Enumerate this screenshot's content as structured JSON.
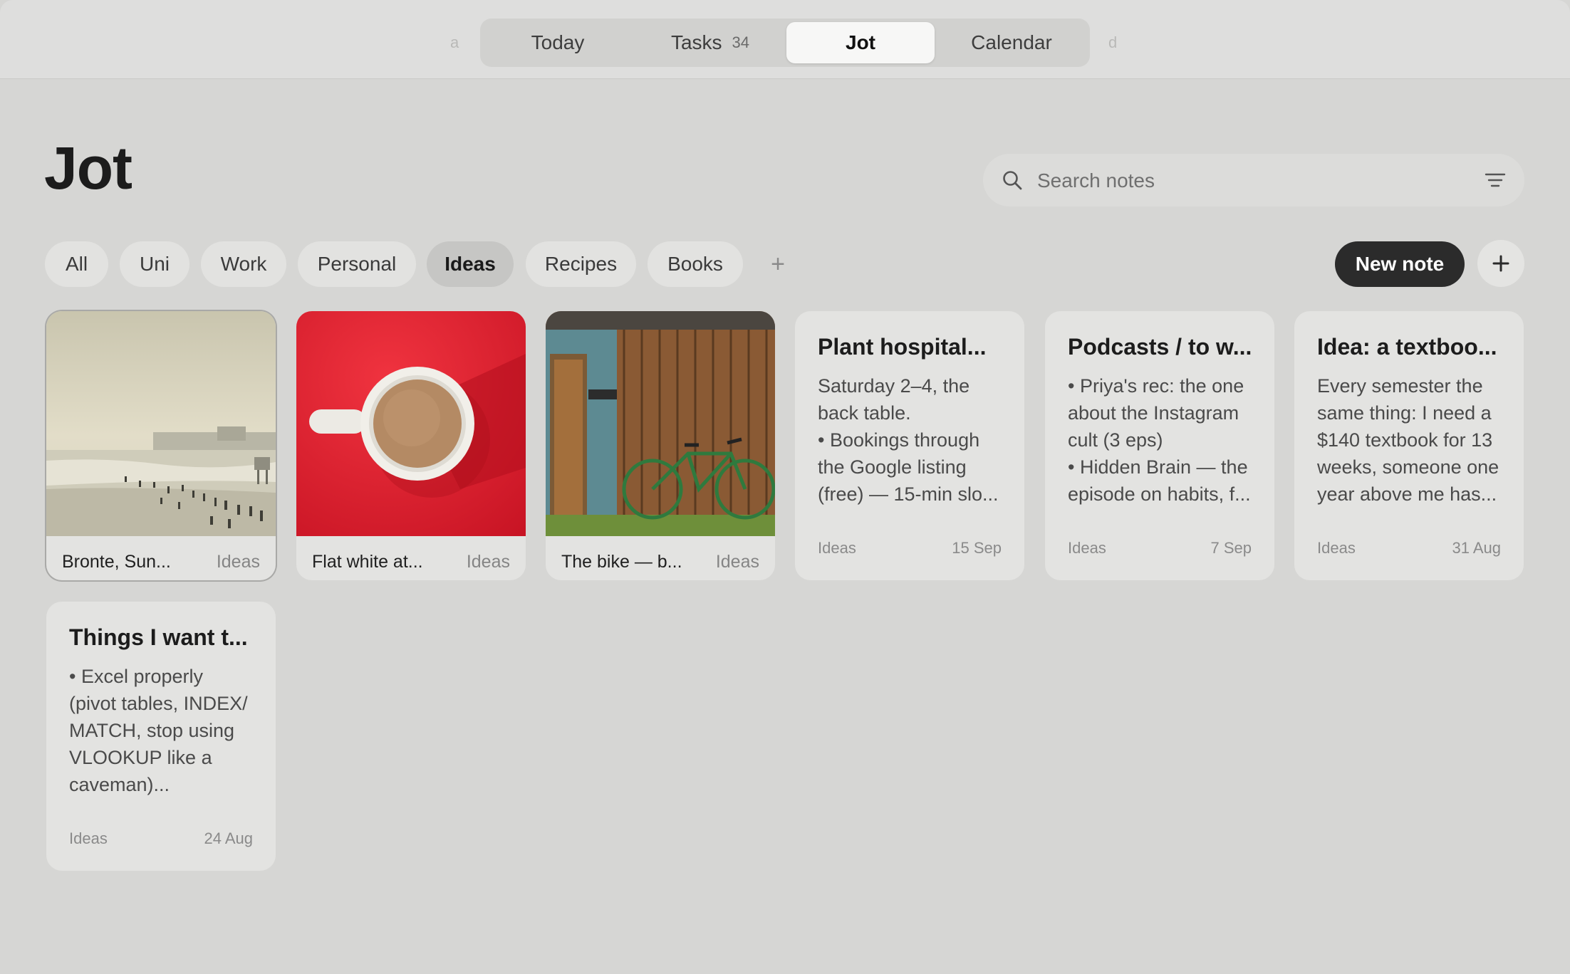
{
  "nav": {
    "hint_left": "a",
    "hint_right": "d",
    "tabs": [
      {
        "label": "Today"
      },
      {
        "label": "Tasks",
        "count": "34"
      },
      {
        "label": "Jot"
      },
      {
        "label": "Calendar"
      }
    ],
    "active_tab": "Jot"
  },
  "header": {
    "title": "Jot",
    "search_placeholder": "Search notes"
  },
  "filters": {
    "chips": [
      "All",
      "Uni",
      "Work",
      "Personal",
      "Ideas",
      "Recipes",
      "Books"
    ],
    "active": "Ideas",
    "add_symbol": "+"
  },
  "actions": {
    "new_note_label": "New note"
  },
  "notes": [
    {
      "type": "image",
      "image": "beach-scene",
      "title": "Bronte, Sun...",
      "tag": "Ideas",
      "selected": true
    },
    {
      "type": "image",
      "image": "coffee-cup-on-red",
      "title": "Flat white at...",
      "tag": "Ideas"
    },
    {
      "type": "image",
      "image": "bicycle-by-wooden-shed",
      "title": "The bike — b...",
      "tag": "Ideas"
    },
    {
      "type": "text",
      "title": "Plant hospital...",
      "body": "Saturday 2–4, the\nback table.\n• Bookings through\nthe Google listing\n(free) — 15-min slo...",
      "tag": "Ideas",
      "date": "15 Sep"
    },
    {
      "type": "text",
      "title": "Podcasts / to w...",
      "body": "• Priya's rec: the one\nabout the Instagram\ncult (3 eps)\n• Hidden Brain — the\nepisode on habits, f...",
      "tag": "Ideas",
      "date": "7 Sep"
    },
    {
      "type": "text",
      "title": "Idea: a textboo...",
      "body": "Every semester the\nsame thing: I need a\n$140 textbook for 13\nweeks, someone one\nyear above me has...",
      "tag": "Ideas",
      "date": "31 Aug"
    },
    {
      "type": "text",
      "title": "Things I want t...",
      "body": "• Excel properly\n(pivot tables, INDEX/\nMATCH, stop using\nVLOOKUP like a\ncaveman)...",
      "tag": "Ideas",
      "date": "24 Aug"
    }
  ],
  "colors": {
    "background": "#d6d6d4",
    "card": "#e3e3e1",
    "accent_dark": "#2b2b2b"
  }
}
